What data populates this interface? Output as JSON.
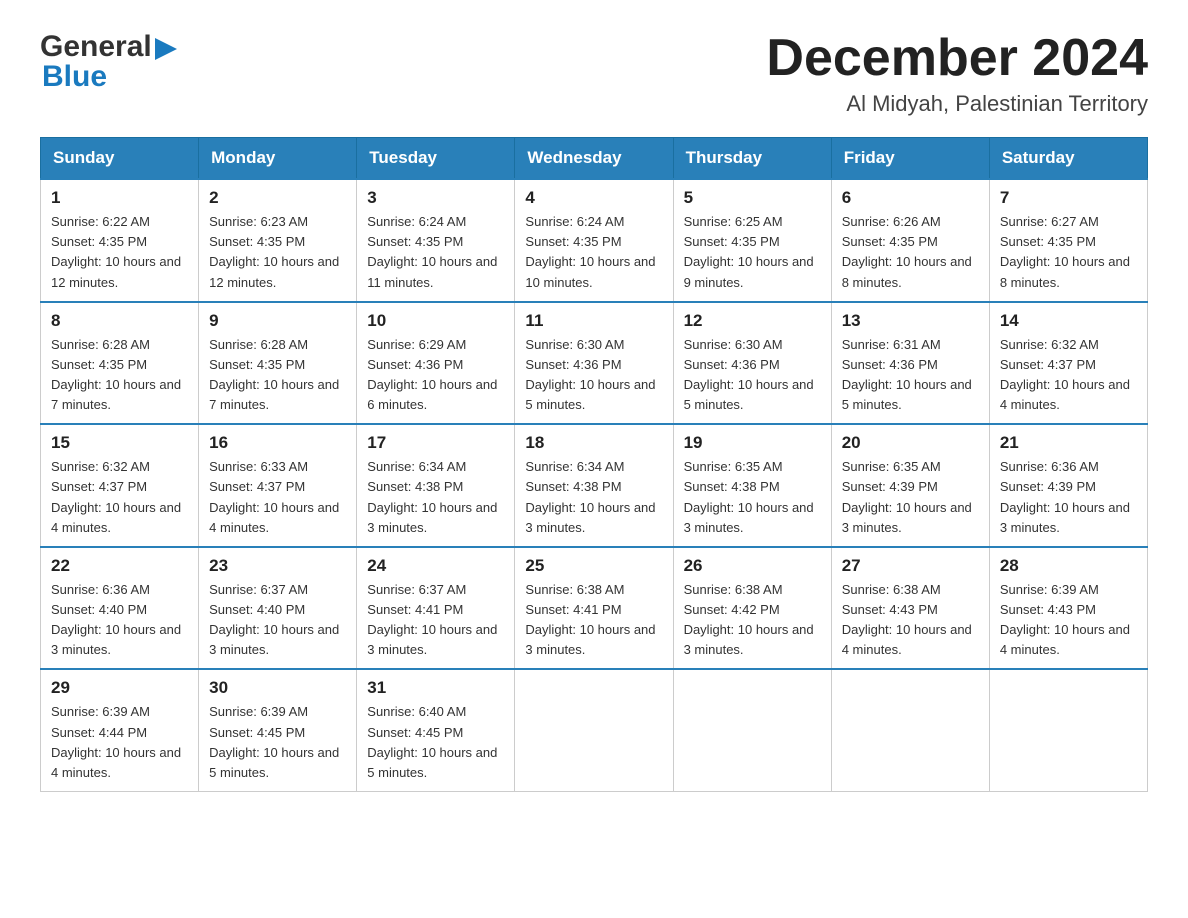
{
  "header": {
    "logo_general": "General",
    "logo_blue": "Blue",
    "month_title": "December 2024",
    "location": "Al Midyah, Palestinian Territory"
  },
  "weekdays": [
    "Sunday",
    "Monday",
    "Tuesday",
    "Wednesday",
    "Thursday",
    "Friday",
    "Saturday"
  ],
  "weeks": [
    [
      {
        "day": "1",
        "sunrise": "Sunrise: 6:22 AM",
        "sunset": "Sunset: 4:35 PM",
        "daylight": "Daylight: 10 hours and 12 minutes."
      },
      {
        "day": "2",
        "sunrise": "Sunrise: 6:23 AM",
        "sunset": "Sunset: 4:35 PM",
        "daylight": "Daylight: 10 hours and 12 minutes."
      },
      {
        "day": "3",
        "sunrise": "Sunrise: 6:24 AM",
        "sunset": "Sunset: 4:35 PM",
        "daylight": "Daylight: 10 hours and 11 minutes."
      },
      {
        "day": "4",
        "sunrise": "Sunrise: 6:24 AM",
        "sunset": "Sunset: 4:35 PM",
        "daylight": "Daylight: 10 hours and 10 minutes."
      },
      {
        "day": "5",
        "sunrise": "Sunrise: 6:25 AM",
        "sunset": "Sunset: 4:35 PM",
        "daylight": "Daylight: 10 hours and 9 minutes."
      },
      {
        "day": "6",
        "sunrise": "Sunrise: 6:26 AM",
        "sunset": "Sunset: 4:35 PM",
        "daylight": "Daylight: 10 hours and 8 minutes."
      },
      {
        "day": "7",
        "sunrise": "Sunrise: 6:27 AM",
        "sunset": "Sunset: 4:35 PM",
        "daylight": "Daylight: 10 hours and 8 minutes."
      }
    ],
    [
      {
        "day": "8",
        "sunrise": "Sunrise: 6:28 AM",
        "sunset": "Sunset: 4:35 PM",
        "daylight": "Daylight: 10 hours and 7 minutes."
      },
      {
        "day": "9",
        "sunrise": "Sunrise: 6:28 AM",
        "sunset": "Sunset: 4:35 PM",
        "daylight": "Daylight: 10 hours and 7 minutes."
      },
      {
        "day": "10",
        "sunrise": "Sunrise: 6:29 AM",
        "sunset": "Sunset: 4:36 PM",
        "daylight": "Daylight: 10 hours and 6 minutes."
      },
      {
        "day": "11",
        "sunrise": "Sunrise: 6:30 AM",
        "sunset": "Sunset: 4:36 PM",
        "daylight": "Daylight: 10 hours and 5 minutes."
      },
      {
        "day": "12",
        "sunrise": "Sunrise: 6:30 AM",
        "sunset": "Sunset: 4:36 PM",
        "daylight": "Daylight: 10 hours and 5 minutes."
      },
      {
        "day": "13",
        "sunrise": "Sunrise: 6:31 AM",
        "sunset": "Sunset: 4:36 PM",
        "daylight": "Daylight: 10 hours and 5 minutes."
      },
      {
        "day": "14",
        "sunrise": "Sunrise: 6:32 AM",
        "sunset": "Sunset: 4:37 PM",
        "daylight": "Daylight: 10 hours and 4 minutes."
      }
    ],
    [
      {
        "day": "15",
        "sunrise": "Sunrise: 6:32 AM",
        "sunset": "Sunset: 4:37 PM",
        "daylight": "Daylight: 10 hours and 4 minutes."
      },
      {
        "day": "16",
        "sunrise": "Sunrise: 6:33 AM",
        "sunset": "Sunset: 4:37 PM",
        "daylight": "Daylight: 10 hours and 4 minutes."
      },
      {
        "day": "17",
        "sunrise": "Sunrise: 6:34 AM",
        "sunset": "Sunset: 4:38 PM",
        "daylight": "Daylight: 10 hours and 3 minutes."
      },
      {
        "day": "18",
        "sunrise": "Sunrise: 6:34 AM",
        "sunset": "Sunset: 4:38 PM",
        "daylight": "Daylight: 10 hours and 3 minutes."
      },
      {
        "day": "19",
        "sunrise": "Sunrise: 6:35 AM",
        "sunset": "Sunset: 4:38 PM",
        "daylight": "Daylight: 10 hours and 3 minutes."
      },
      {
        "day": "20",
        "sunrise": "Sunrise: 6:35 AM",
        "sunset": "Sunset: 4:39 PM",
        "daylight": "Daylight: 10 hours and 3 minutes."
      },
      {
        "day": "21",
        "sunrise": "Sunrise: 6:36 AM",
        "sunset": "Sunset: 4:39 PM",
        "daylight": "Daylight: 10 hours and 3 minutes."
      }
    ],
    [
      {
        "day": "22",
        "sunrise": "Sunrise: 6:36 AM",
        "sunset": "Sunset: 4:40 PM",
        "daylight": "Daylight: 10 hours and 3 minutes."
      },
      {
        "day": "23",
        "sunrise": "Sunrise: 6:37 AM",
        "sunset": "Sunset: 4:40 PM",
        "daylight": "Daylight: 10 hours and 3 minutes."
      },
      {
        "day": "24",
        "sunrise": "Sunrise: 6:37 AM",
        "sunset": "Sunset: 4:41 PM",
        "daylight": "Daylight: 10 hours and 3 minutes."
      },
      {
        "day": "25",
        "sunrise": "Sunrise: 6:38 AM",
        "sunset": "Sunset: 4:41 PM",
        "daylight": "Daylight: 10 hours and 3 minutes."
      },
      {
        "day": "26",
        "sunrise": "Sunrise: 6:38 AM",
        "sunset": "Sunset: 4:42 PM",
        "daylight": "Daylight: 10 hours and 3 minutes."
      },
      {
        "day": "27",
        "sunrise": "Sunrise: 6:38 AM",
        "sunset": "Sunset: 4:43 PM",
        "daylight": "Daylight: 10 hours and 4 minutes."
      },
      {
        "day": "28",
        "sunrise": "Sunrise: 6:39 AM",
        "sunset": "Sunset: 4:43 PM",
        "daylight": "Daylight: 10 hours and 4 minutes."
      }
    ],
    [
      {
        "day": "29",
        "sunrise": "Sunrise: 6:39 AM",
        "sunset": "Sunset: 4:44 PM",
        "daylight": "Daylight: 10 hours and 4 minutes."
      },
      {
        "day": "30",
        "sunrise": "Sunrise: 6:39 AM",
        "sunset": "Sunset: 4:45 PM",
        "daylight": "Daylight: 10 hours and 5 minutes."
      },
      {
        "day": "31",
        "sunrise": "Sunrise: 6:40 AM",
        "sunset": "Sunset: 4:45 PM",
        "daylight": "Daylight: 10 hours and 5 minutes."
      },
      null,
      null,
      null,
      null
    ]
  ]
}
